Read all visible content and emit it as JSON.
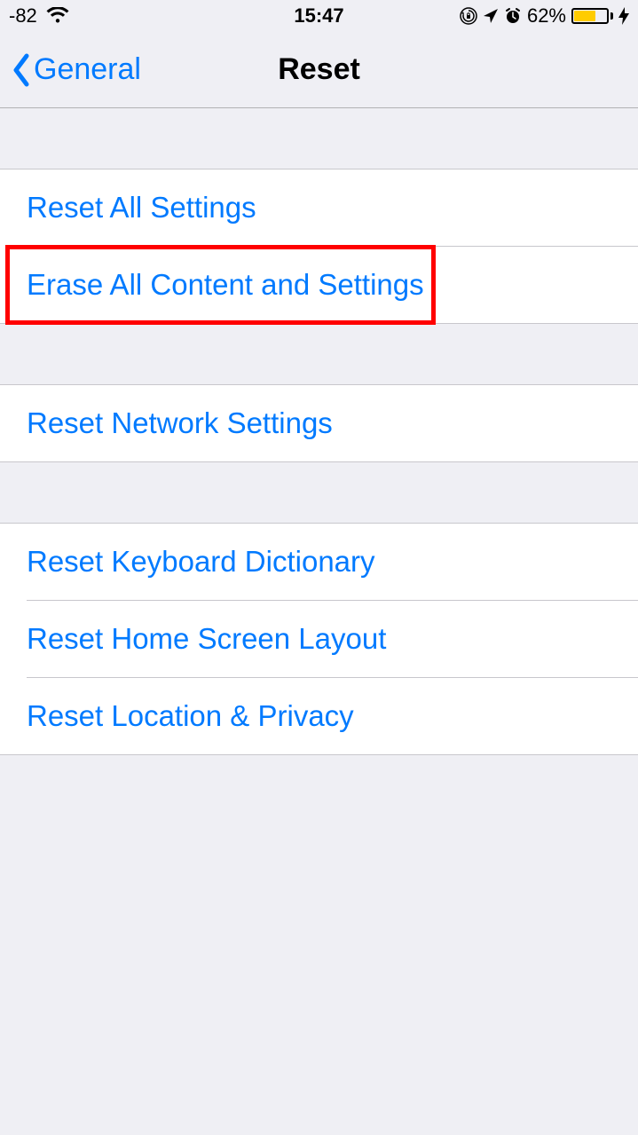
{
  "status_bar": {
    "signal": "-82",
    "time": "15:47",
    "battery_pct": "62%",
    "battery_fill_pct": 62
  },
  "nav": {
    "back_label": "General",
    "title": "Reset"
  },
  "groups": [
    {
      "cells": [
        {
          "key": "reset-all-settings",
          "label": "Reset All Settings"
        },
        {
          "key": "erase-all-content",
          "label": "Erase All Content and Settings"
        }
      ]
    },
    {
      "cells": [
        {
          "key": "reset-network-settings",
          "label": "Reset Network Settings"
        }
      ]
    },
    {
      "cells": [
        {
          "key": "reset-keyboard-dictionary",
          "label": "Reset Keyboard Dictionary"
        },
        {
          "key": "reset-home-screen-layout",
          "label": "Reset Home Screen Layout"
        },
        {
          "key": "reset-location-privacy",
          "label": "Reset Location & Privacy"
        }
      ]
    }
  ],
  "highlight": {
    "target_key": "erase-all-content"
  }
}
